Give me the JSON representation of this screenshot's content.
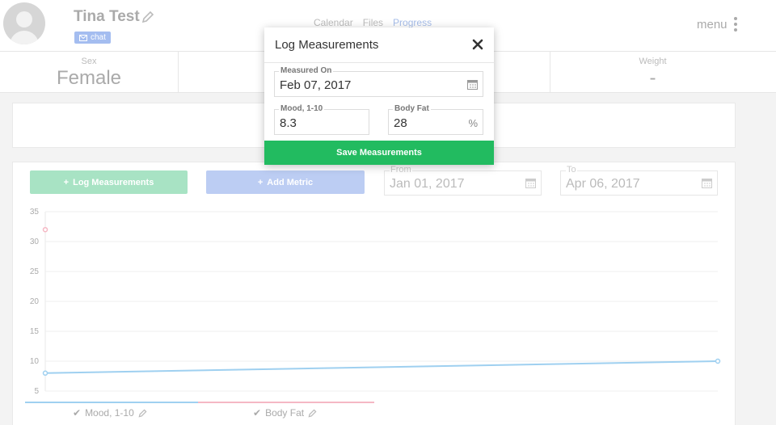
{
  "header": {
    "user_name": "Tina Test",
    "chat_label": "chat",
    "nav": [
      "Calendar",
      "Files",
      "Progress"
    ],
    "menu_label": "menu"
  },
  "stats": {
    "sex_label": "Sex",
    "sex_value": "Female",
    "weight_label": "Weight",
    "weight_value": "-"
  },
  "toolbar": {
    "log_label": "Log Measurements",
    "add_metric_label": "Add Metric",
    "from_label": "From",
    "from_value": "Jan 01, 2017",
    "to_label": "To",
    "to_value": "Apr 06, 2017"
  },
  "modal": {
    "title": "Log Measurements",
    "measured_on_label": "Measured On",
    "measured_on_value": "Feb 07, 2017",
    "mood_label": "Mood, 1-10",
    "mood_value": "8.3",
    "body_fat_label": "Body Fat",
    "body_fat_value": "28",
    "body_fat_unit": "%",
    "save_label": "Save Measurements"
  },
  "colors": {
    "mood": "#9fd0f0",
    "body_fat": "#f5b8c4",
    "green": "#22bb60",
    "blue_btn": "#bccdf3",
    "green_btn": "#a8e3c4"
  },
  "chart_data": {
    "type": "line",
    "ylim": [
      5,
      35
    ],
    "yticks": [
      "35",
      "30",
      "25",
      "20",
      "15",
      "10",
      "5"
    ],
    "series": [
      {
        "name": "Mood, 1-10",
        "color": "#9fd0f0",
        "points": [
          [
            0,
            8
          ],
          [
            1,
            10
          ]
        ]
      },
      {
        "name": "Body Fat",
        "color": "#f5b8c4",
        "points": [
          [
            0,
            32
          ]
        ]
      }
    ]
  }
}
